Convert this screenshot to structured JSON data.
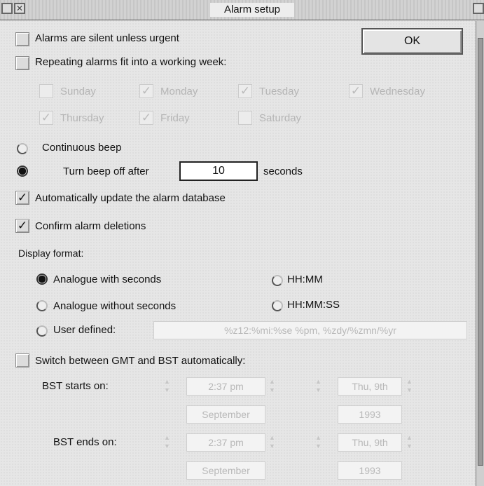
{
  "window": {
    "title": "Alarm setup"
  },
  "ok_label": "OK",
  "options": {
    "silent_label": "Alarms are silent unless urgent",
    "repeat_label": "Repeating alarms fit into a working week:",
    "days": [
      "Sunday",
      "Monday",
      "Tuesday",
      "Wednesday",
      "Thursday",
      "Friday",
      "Saturday"
    ],
    "continuous_label": "Continuous beep",
    "turnoff_label": "Turn beep off after",
    "turnoff_value": "10",
    "seconds_label": "seconds",
    "update_db_label": "Automatically update the alarm database",
    "confirm_label": "Confirm alarm deletions"
  },
  "display": {
    "heading": "Display format:",
    "analogue_sec": "Analogue with seconds",
    "analogue_nosec": "Analogue without seconds",
    "hhmm": "HH:MM",
    "hhmmss": "HH:MM:SS",
    "user_defined": "User defined:",
    "user_format": "%z12:%mi:%se %pm, %zdy/%zmn/%yr"
  },
  "bst": {
    "switch_label": "Switch between GMT and BST automatically:",
    "starts_label": "BST starts on:",
    "ends_label": "BST ends on:",
    "start_time": "2:37 pm",
    "start_day": "Thu, 9th",
    "start_month": "September",
    "start_year": "1993",
    "end_time": "2:37 pm",
    "end_day": "Thu, 9th",
    "end_month": "September",
    "end_year": "1993"
  },
  "checked": {
    "check": "✓"
  }
}
